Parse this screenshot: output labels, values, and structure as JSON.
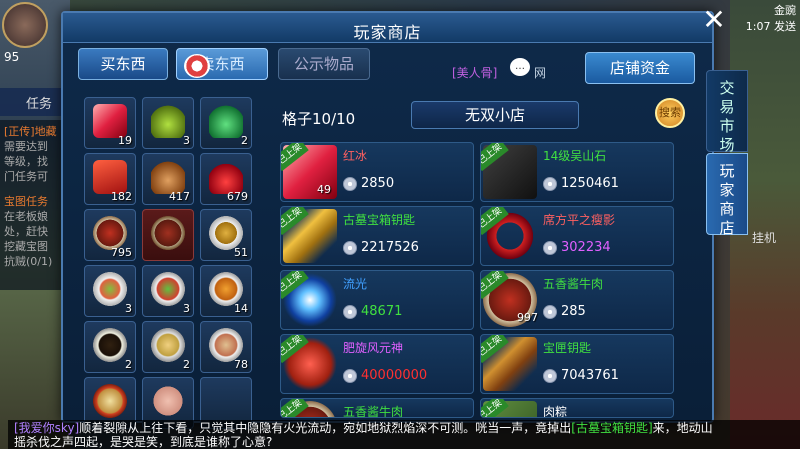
{
  "bg": {
    "level": "95",
    "task_label": "任务",
    "quest_lines": [
      "[正传]地藏",
      "需要达到",
      "等级，找",
      "门任务可"
    ],
    "quest_lines2": [
      "宝图任务",
      "在老板娘",
      "处，赶快",
      "挖藏宝图",
      "抗贼(0/1)"
    ],
    "coin_top": "金豌",
    "coin_value": "1:07 发送",
    "afk_label": "挂机"
  },
  "panel": {
    "title": "玩家商店"
  },
  "tabs": {
    "buy": "买东西",
    "sell": "卖东西",
    "public": "公示物品"
  },
  "chat_tag": {
    "user": "[美人骨]",
    "net": "网"
  },
  "funds_button": "店铺资金",
  "grid_count": "格子10/10",
  "shop_name": "无双小店",
  "search_label": "搜索",
  "inventory": [
    {
      "icon": "red-crystal",
      "count": "19"
    },
    {
      "icon": "green-gourd",
      "count": "3"
    },
    {
      "icon": "green-vase",
      "count": "2"
    },
    {
      "icon": "red-package",
      "count": "182"
    },
    {
      "icon": "wine-jar",
      "count": "417"
    },
    {
      "icon": "red-bottle",
      "count": "679"
    },
    {
      "icon": "braised-meat",
      "count": "795"
    },
    {
      "icon": "braised-meat-selected",
      "count": ""
    },
    {
      "icon": "stir-fry",
      "count": "51"
    },
    {
      "icon": "salad-dish",
      "count": "3"
    },
    {
      "icon": "vegetable-dish",
      "count": "3"
    },
    {
      "icon": "fried-dish",
      "count": "14"
    },
    {
      "icon": "soup-pot",
      "count": "2"
    },
    {
      "icon": "dumpling-dish",
      "count": "2"
    },
    {
      "icon": "dim-sum",
      "count": "78"
    },
    {
      "icon": "noodle-bowl",
      "count": ""
    },
    {
      "icon": "pig-head",
      "count": ""
    },
    {
      "icon": "",
      "count": ""
    }
  ],
  "shop_items": [
    {
      "name": "红冰",
      "name_color": "#ff6060",
      "price": "2850",
      "price_color": "#ffffff",
      "qty": "49",
      "badge": "已上架",
      "thumb": "red-crystal"
    },
    {
      "name": "14级吴山石",
      "name_color": "#40e040",
      "price": "1250461",
      "price_color": "#ffffff",
      "qty": "",
      "badge": "已上架",
      "thumb": "dark-stone"
    },
    {
      "name": "古墓宝箱钥匙",
      "name_color": "#40e040",
      "price": "2217526",
      "price_color": "#ffffff",
      "qty": "",
      "badge": "已上架",
      "thumb": "golden-key"
    },
    {
      "name": "席方平之瘦影",
      "name_color": "#ff6060",
      "price": "302234",
      "price_color": "#e060ff",
      "qty": "",
      "badge": "已上架",
      "thumb": "red-ring"
    },
    {
      "name": "流光",
      "name_color": "#40a0ff",
      "price": "48671",
      "price_color": "#40e040",
      "qty": "",
      "badge": "已上架",
      "thumb": "blue-light"
    },
    {
      "name": "五香酱牛肉",
      "name_color": "#40e040",
      "price": "285",
      "price_color": "#ffffff",
      "qty": "997",
      "badge": "已上架",
      "thumb": "braised-meat"
    },
    {
      "name": "肥旋风元神",
      "name_color": "#e060ff",
      "price": "40000000",
      "price_color": "#ff3030",
      "qty": "",
      "badge": "已上架",
      "thumb": "red-beast"
    },
    {
      "name": "宝匣钥匙",
      "name_color": "#40e040",
      "price": "7043761",
      "price_color": "#ffffff",
      "qty": "",
      "badge": "已上架",
      "thumb": "bronze-key"
    },
    {
      "name": "五香酱牛肉",
      "name_color": "#40e040",
      "price": "",
      "price_color": "#ffffff",
      "qty": "",
      "badge": "已上架",
      "thumb": "braised-meat"
    },
    {
      "name": "肉粽",
      "name_color": "#ffffff",
      "price": "",
      "price_color": "#ffffff",
      "qty": "",
      "badge": "已上架",
      "thumb": "rice-dumpling"
    }
  ],
  "side_tabs": {
    "trade": "交易市场",
    "player": "玩家商店"
  },
  "chat": {
    "user": "[我爱你sky]",
    "text1": "顺着裂隙从上往下看，只觉其中隐隐有火光流动，宛如地狱烈焰深不可测。咣当一声，竟掉出",
    "item": "[古墓宝箱钥匙]",
    "text2": "来，地动山",
    "text3": "摇杀伐之声四起，是哭是笑，到底是谁称了心意?"
  }
}
